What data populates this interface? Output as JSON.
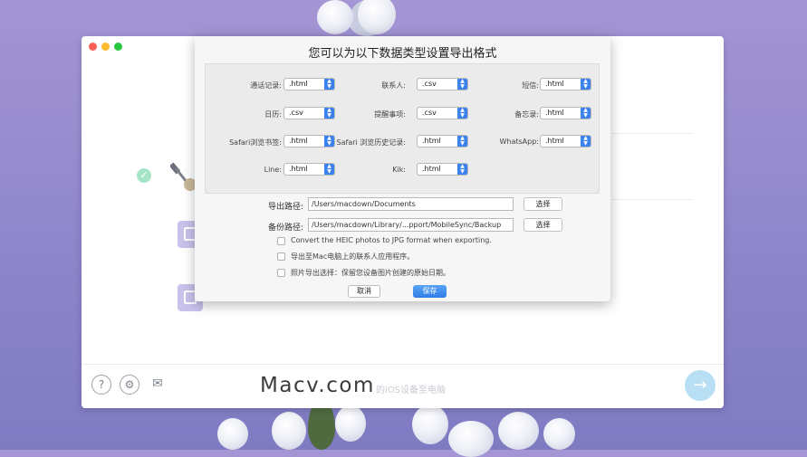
{
  "dialog": {
    "title": "您可以为以下数据类型设置导出格式",
    "formats": [
      {
        "label": "通话记录:",
        "value": ".html"
      },
      {
        "label": "联系人:",
        "value": ".csv"
      },
      {
        "label": "短信:",
        "value": ".html"
      },
      {
        "label": "日历:",
        "value": ".csv"
      },
      {
        "label": "提醒事项:",
        "value": ".csv"
      },
      {
        "label": "备忘录:",
        "value": ".html"
      },
      {
        "label": "Safari浏览书签:",
        "value": ".html"
      },
      {
        "label": "Safari 浏览历史记录:",
        "value": ".html"
      },
      {
        "label": "WhatsApp:",
        "value": ".html"
      },
      {
        "label": "Line:",
        "value": ".html"
      },
      {
        "label": "Kik:",
        "value": ".html"
      }
    ],
    "export_path_label": "导出路径:",
    "export_path_value": "/Users/macdown/Documents",
    "backup_path_label": "备份路径:",
    "backup_path_value": "/Users/macdown/Library/...pport/MobileSync/Backup",
    "choose_label": "选择",
    "options": [
      {
        "label": "Convert the HEIC photos to JPG format when exporting.",
        "checked": false
      },
      {
        "label": "导出至Mac电脑上的联系人应用程序。",
        "checked": false
      },
      {
        "label": "照片导出选择：保留您设备图片创建的原始日期。",
        "checked": false
      }
    ],
    "cancel_label": "取消",
    "save_label": "保存"
  },
  "main": {
    "footer_text": "的iOS设备至电脑",
    "watermark": "Macv.com",
    "footer_icons": [
      "help-icon",
      "settings-icon",
      "mail-icon"
    ]
  },
  "colors": {
    "accent": "#3b82f0",
    "next_button": "#b8dff4",
    "background": "#9a90d0"
  }
}
